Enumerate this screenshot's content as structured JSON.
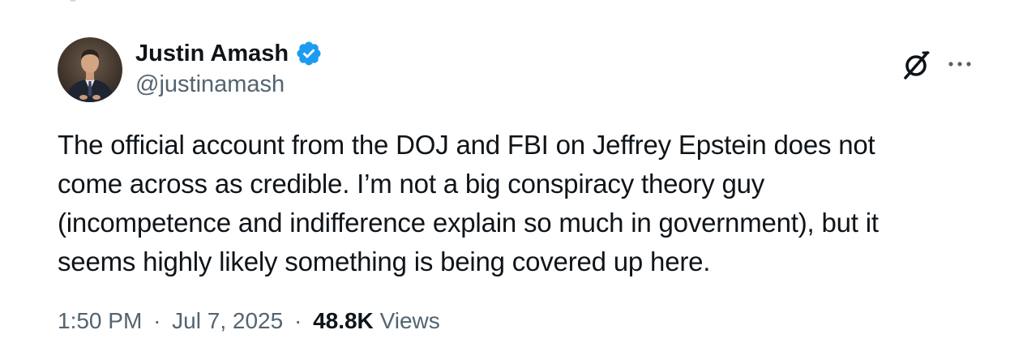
{
  "author": {
    "display_name": "Justin Amash",
    "handle": "@justinamash",
    "verified": true,
    "verified_color": "#1d9bf0"
  },
  "icons": {
    "avatar": "profile-photo",
    "verified": "verified-badge-icon",
    "grok": "grok-icon",
    "more": "more-horizontal-icon"
  },
  "tweet": {
    "lines": [
      "The official account from the DOJ and FBI on Jeffrey Epstein does not",
      "come across as credible. I’m not a big conspiracy theory guy",
      "(incompetence and indifference explain so much in government), but it",
      "seems highly likely something is being covered up here."
    ]
  },
  "meta": {
    "time": "1:50 PM",
    "separator": "·",
    "date": "Jul 7, 2025",
    "views_count": "48.8K",
    "views_label": "Views"
  },
  "colors": {
    "text_primary": "#0f1419",
    "text_secondary": "#536471",
    "background": "#ffffff"
  }
}
